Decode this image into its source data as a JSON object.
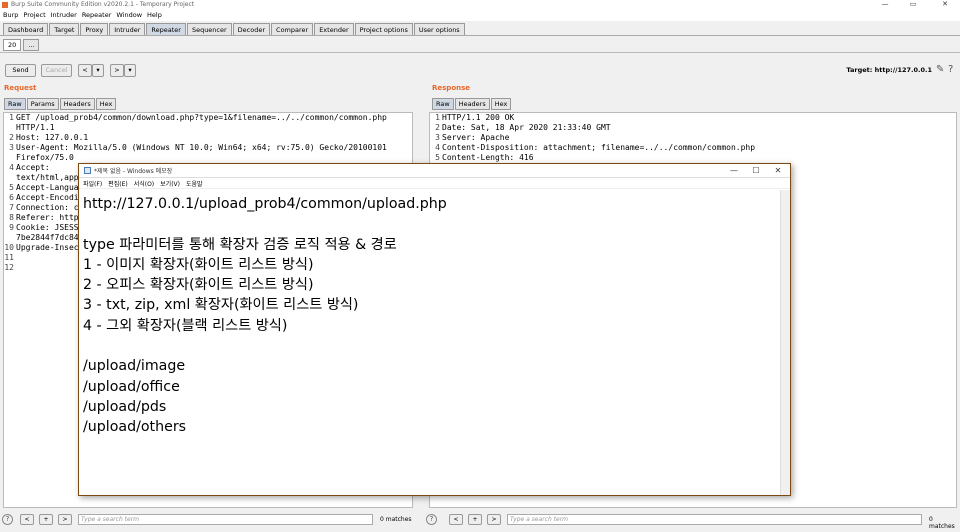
{
  "window": {
    "title": "Burp Suite Community Edition v2020.2.1 - Temporary Project"
  },
  "menu": [
    "Burp",
    "Project",
    "Intruder",
    "Repeater",
    "Window",
    "Help"
  ],
  "main_tabs": [
    {
      "label": "Dashboard"
    },
    {
      "label": "Target"
    },
    {
      "label": "Proxy"
    },
    {
      "label": "Intruder"
    },
    {
      "label": "Repeater",
      "active": true
    },
    {
      "label": "Sequencer"
    },
    {
      "label": "Decoder"
    },
    {
      "label": "Comparer"
    },
    {
      "label": "Extender"
    },
    {
      "label": "Project options"
    },
    {
      "label": "User options"
    }
  ],
  "sub_tabs": [
    {
      "label": "20",
      "active": true
    },
    {
      "label": "..."
    }
  ],
  "toolbar": {
    "send": "Send",
    "cancel": "Cancel",
    "back": "<",
    "back_drop": "▾",
    "forward": ">",
    "forward_drop": "▾",
    "target": "Target: http://127.0.0.1"
  },
  "request": {
    "title": "Request",
    "tabs": [
      {
        "label": "Raw",
        "active": true
      },
      {
        "label": "Params"
      },
      {
        "label": "Headers"
      },
      {
        "label": "Hex"
      }
    ],
    "lines": [
      {
        "n": "1",
        "t": "GET /upload_prob4/common/download.php?type=1&filename=../../common/common.php"
      },
      {
        "n": "",
        "t": "HTTP/1.1"
      },
      {
        "n": "2",
        "t": "Host: 127.0.0.1"
      },
      {
        "n": "3",
        "t": "User-Agent: Mozilla/5.0 (Windows NT 10.0; Win64; x64; rv:75.0) Gecko/20100101"
      },
      {
        "n": "",
        "t": "Firefox/75.0"
      },
      {
        "n": "4",
        "t": "Accept:"
      },
      {
        "n": "",
        "t": "text/html,app"
      },
      {
        "n": "5",
        "t": "Accept-Langua"
      },
      {
        "n": "6",
        "t": "Accept-Encodi"
      },
      {
        "n": "7",
        "t": "Connection: c"
      },
      {
        "n": "8",
        "t": "Referer: http"
      },
      {
        "n": "9",
        "t": "Cookie: JSESS"
      },
      {
        "n": "",
        "t": "7be2844f7dc84"
      },
      {
        "n": "10",
        "t": "Upgrade-Insec"
      },
      {
        "n": "11",
        "t": ""
      },
      {
        "n": "12",
        "t": ""
      }
    ]
  },
  "response": {
    "title": "Response",
    "tabs": [
      {
        "label": "Raw",
        "active": true
      },
      {
        "label": "Headers"
      },
      {
        "label": "Hex"
      }
    ],
    "lines": [
      {
        "n": "1",
        "t": "HTTP/1.1 200 OK"
      },
      {
        "n": "2",
        "t": "Date: Sat, 18 Apr 2020 21:33:40 GMT"
      },
      {
        "n": "3",
        "t": "Server: Apache"
      },
      {
        "n": "4",
        "t": "Content-Disposition: attachment; filename=../../common/common.php"
      },
      {
        "n": "5",
        "t": "Content-Length: 416"
      }
    ]
  },
  "search": {
    "placeholder": "Type a search term",
    "matches": "0 matches",
    "help": "?",
    "prev": "<",
    "add": "+",
    "next": ">"
  },
  "notepad": {
    "title": "*제목 없음 - Windows 메모장",
    "menu": [
      "파일(F)",
      "편집(E)",
      "서식(O)",
      "보기(V)",
      "도움말"
    ],
    "lines": [
      "http://127.0.0.1/upload_prob4/common/upload.php",
      "",
      "type 파라미터를 통해 확장자 검증 로직 적용 & 경로",
      "1 - 이미지 확장자(화이트 리스트 방식)",
      "2 - 오피스 확장자(화이트 리스트 방식)",
      "3 - txt, zip, xml 확장자(화이트 리스트 방식)",
      "4 - 그외 확장자(블랙 리스트 방식)",
      "",
      "/upload/image",
      "/upload/office",
      "/upload/pds",
      "/upload/others"
    ]
  }
}
